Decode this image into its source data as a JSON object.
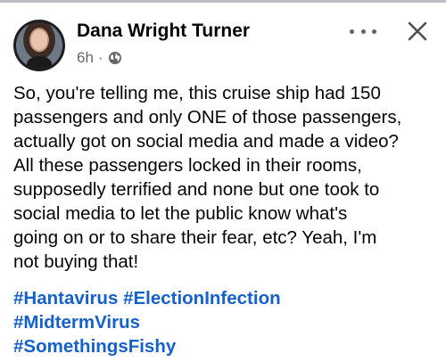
{
  "post": {
    "author": "Dana Wright Turner",
    "time": "6h",
    "separator": "·",
    "privacy_icon": "globe-icon",
    "more_icon": "more-horizontal-icon",
    "close_icon": "close-icon",
    "body_lines": [
      "So, you're telling me, this cruise ship had 150",
      "passengers and only ONE of those passengers,",
      "actually got on social media and made a video?",
      "All these passengers locked in their rooms,",
      "supposedly terrified and none but one took to",
      "social media to let the public know what's",
      "going on or to share their fear, etc? Yeah, I'm",
      "not buying that!"
    ],
    "hashtags": [
      "#Hantavirus",
      "#ElectionInfection",
      "#MidtermVirus",
      "#SomethingsFishy"
    ]
  },
  "colors": {
    "hashtag": "#1461c9",
    "meta": "#65676b",
    "text": "#050505"
  }
}
